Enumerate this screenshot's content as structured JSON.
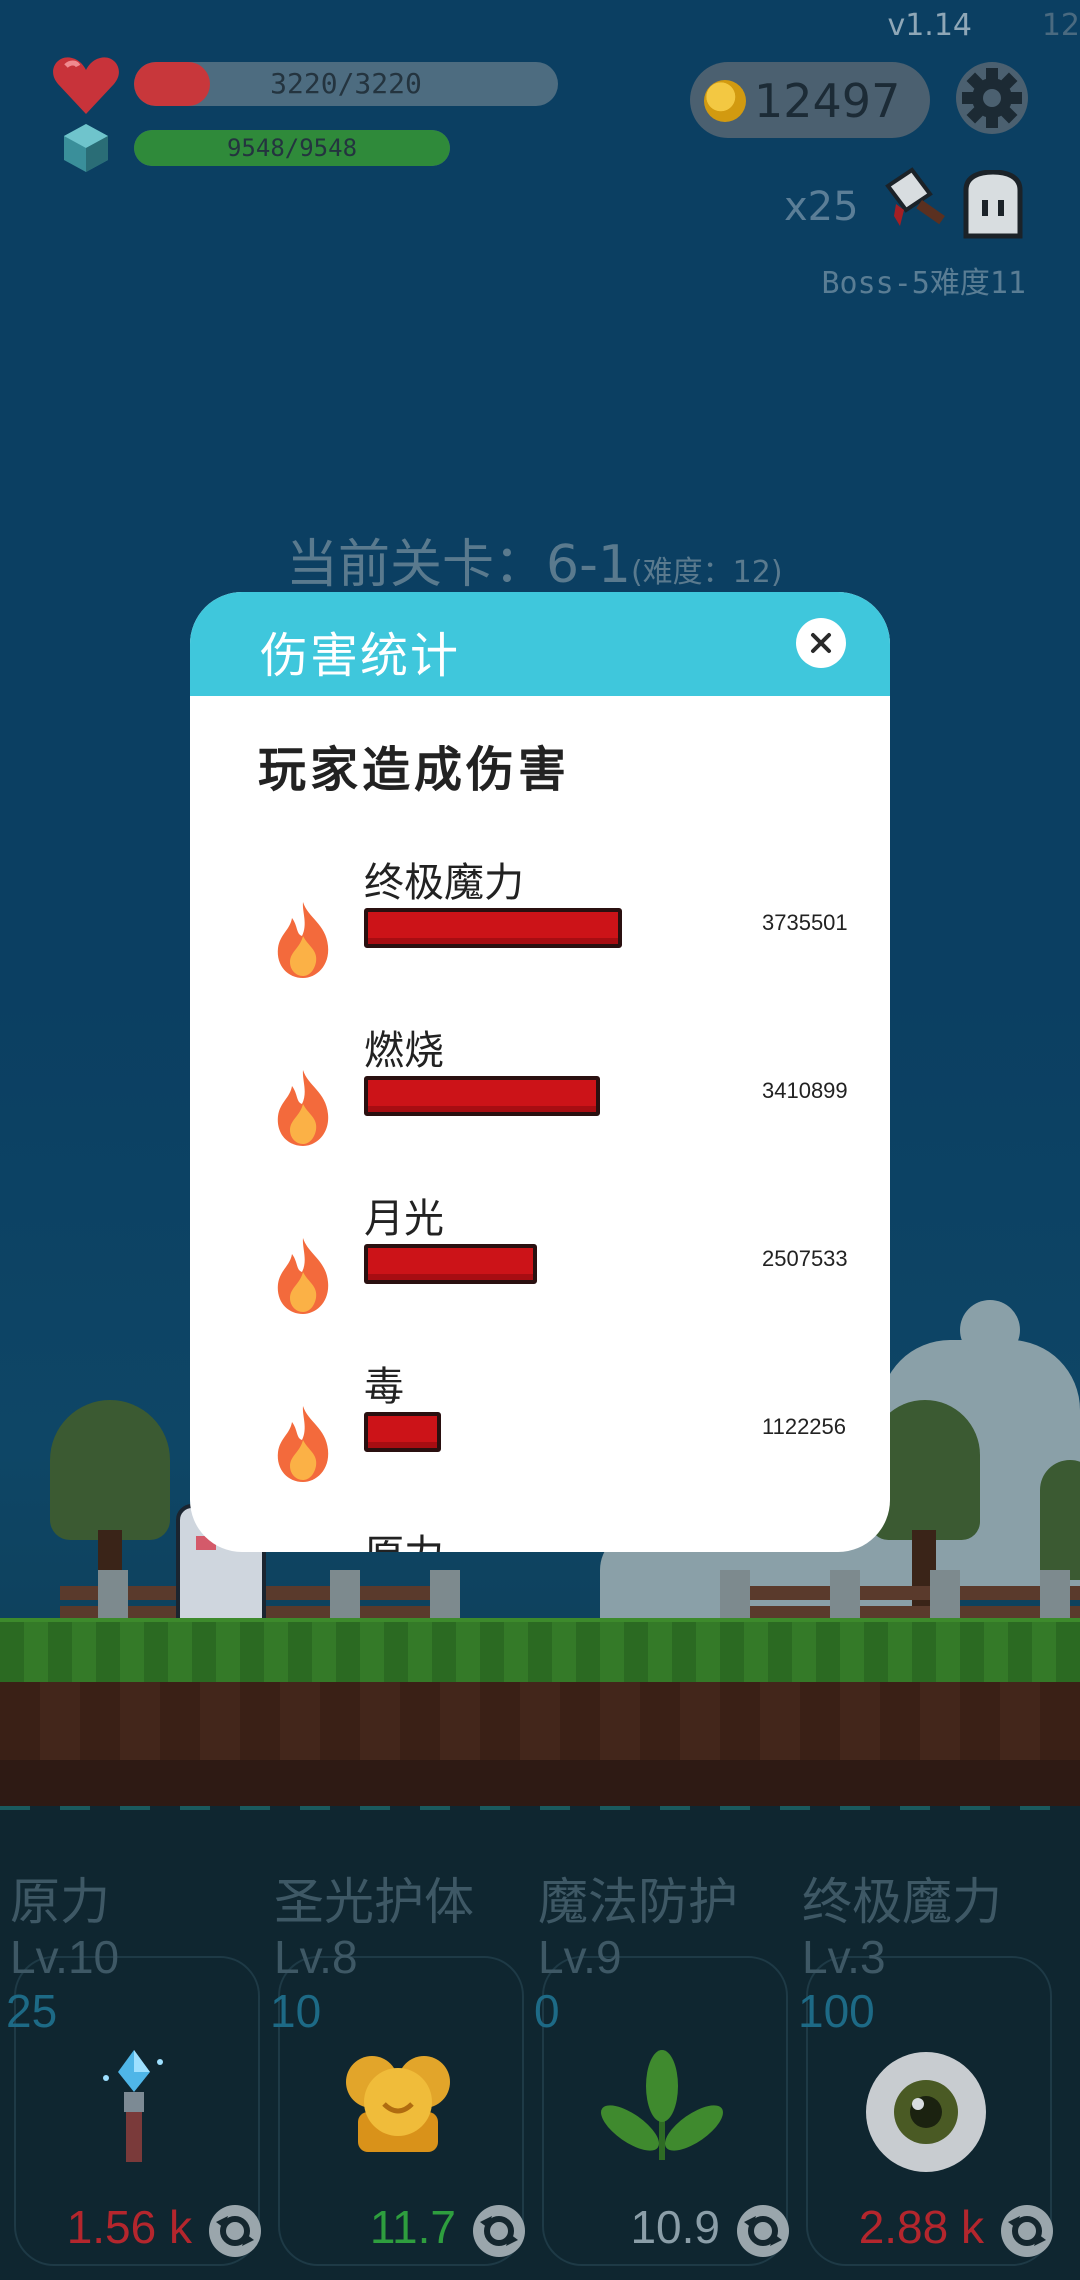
{
  "hud": {
    "version": "v1.14",
    "version_ghost": "12",
    "hp": {
      "text": "3220/3220",
      "fill_fraction": 0.18,
      "fill_color": "#c8373b"
    },
    "mp": {
      "text": "9548/9548",
      "fill_fraction": 1.0,
      "fill_color": "#2f8a3a"
    },
    "coins": "12497",
    "multiplier": "x25",
    "boss": "Boss-5难度11"
  },
  "stage": {
    "label": "当前关卡：6-1",
    "difficulty": "(难度：12)"
  },
  "dialog": {
    "title": "伤害统计",
    "section_title": "玩家造成伤害",
    "rows": [
      {
        "name": "终极魔力",
        "value": "3735501",
        "bar_fraction": 1.0
      },
      {
        "name": "燃烧",
        "value": "3410899",
        "bar_fraction": 0.913
      },
      {
        "name": "月光",
        "value": "2507533",
        "bar_fraction": 0.671
      },
      {
        "name": "毒",
        "value": "1122256",
        "bar_fraction": 0.3
      },
      {
        "name": "原力",
        "value": "",
        "bar_fraction": 0
      }
    ]
  },
  "skills": [
    {
      "name": "原力",
      "level": "Lv.10",
      "cost": "25",
      "value": "1.56 k",
      "value_color": "#b4262d",
      "icon": "crystal-torch-icon"
    },
    {
      "name": "圣光护体",
      "level": "Lv.8",
      "cost": "10",
      "value": "11.7",
      "value_color": "#2e9e3e",
      "icon": "holy-shield-icon"
    },
    {
      "name": "魔法防护",
      "level": "Lv.9",
      "cost": "0",
      "value": "10.9",
      "value_color": "#8b9ea8",
      "icon": "leaf-icon"
    },
    {
      "name": "终极魔力",
      "level": "Lv.3",
      "cost": "100",
      "value": "2.88 k",
      "value_color": "#b4262d",
      "icon": "eye-orb-icon"
    }
  ],
  "colors": {
    "dialog_header": "#3fc7dc",
    "damage_bar": "#cc1318"
  }
}
